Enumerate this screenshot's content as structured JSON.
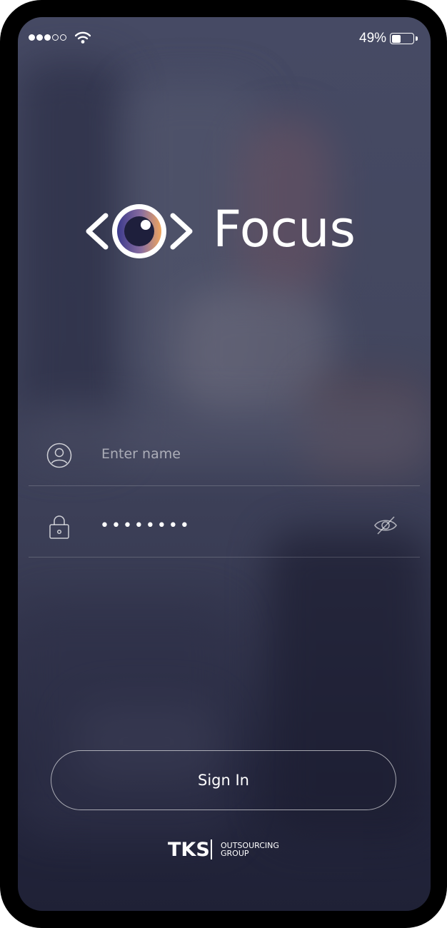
{
  "status_bar": {
    "signal_bars_filled": 3,
    "signal_bars_total": 5,
    "battery_percent": "49%",
    "battery_level": 0.49
  },
  "app": {
    "name": "Focus"
  },
  "login": {
    "name_placeholder": "Enter name",
    "password_masked": "••••••••",
    "sign_in_label": "Sign In"
  },
  "footer": {
    "brand": "TKS",
    "brand_line1": "OUTSOURCING",
    "brand_line2": "GROUP"
  },
  "colors": {
    "background_top": "#464a64",
    "background_bottom": "#1f2136",
    "logo_gradient_start": "#3b3a8c",
    "logo_gradient_end": "#f0a65e"
  },
  "icons": [
    "signal-dots-icon",
    "wifi-icon",
    "battery-icon",
    "eye-logo-icon",
    "user-icon",
    "lock-icon",
    "eye-slash-icon"
  ]
}
